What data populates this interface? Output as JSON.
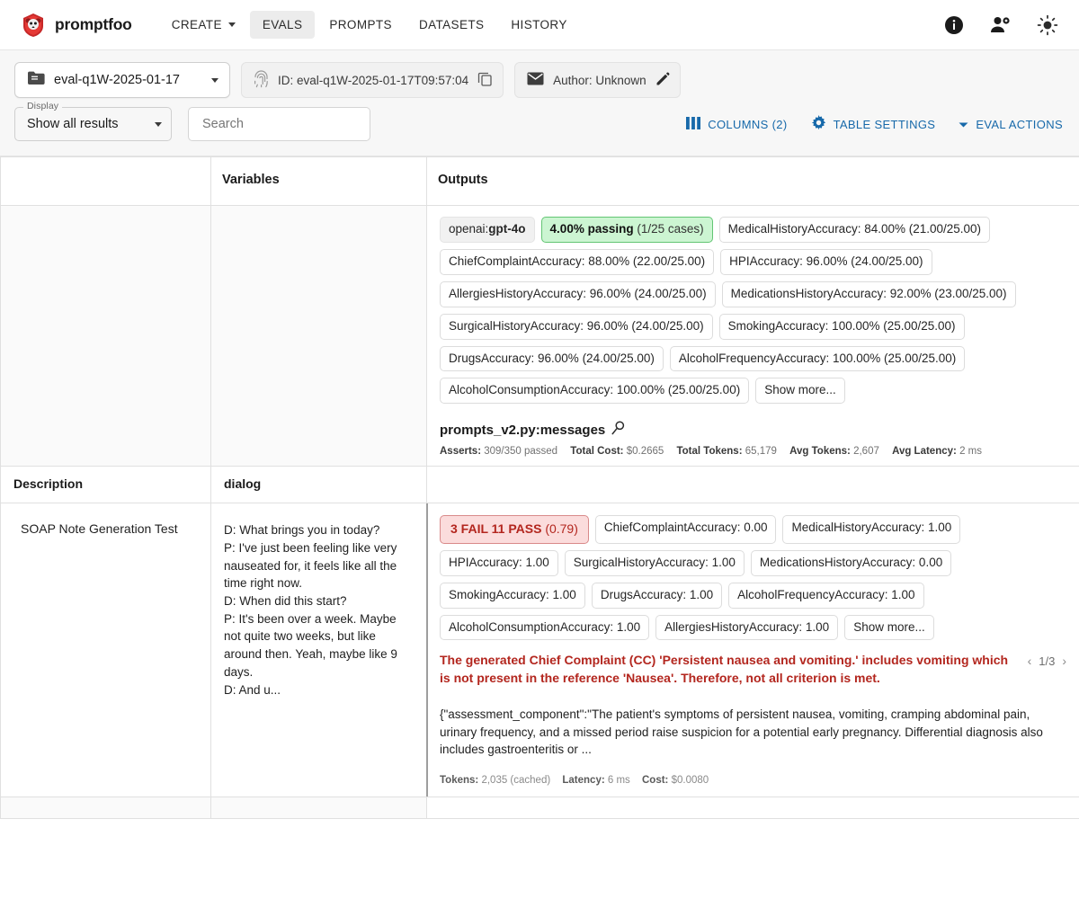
{
  "nav": {
    "brand": "promptfoo",
    "items": [
      {
        "label": "CREATE",
        "has_caret": true,
        "active": false
      },
      {
        "label": "EVALS",
        "has_caret": false,
        "active": true
      },
      {
        "label": "PROMPTS",
        "has_caret": false,
        "active": false
      },
      {
        "label": "DATASETS",
        "has_caret": false,
        "active": false
      },
      {
        "label": "HISTORY",
        "has_caret": false,
        "active": false
      }
    ],
    "right_icons": [
      "info-icon",
      "user-settings-icon",
      "light-mode-icon"
    ]
  },
  "evalbar": {
    "eval_name": "eval-q1W-2025-01-17",
    "id_label": "ID: eval-q1W-2025-01-17T09:57:04",
    "author_label": "Author: Unknown"
  },
  "filters": {
    "display_legend": "Display",
    "display_value": "Show all results",
    "search_placeholder": "Search",
    "columns_label": "COLUMNS (2)",
    "table_settings_label": "TABLE SETTINGS",
    "eval_actions_label": "EVAL ACTIONS",
    "accent_color": "#1769aa"
  },
  "table": {
    "headers": {
      "col1": "",
      "col2": "Variables",
      "col3": "Outputs"
    },
    "subheaders": {
      "col1": "Description",
      "col2": "dialog"
    },
    "summary": {
      "model_prefix": "openai:",
      "model_name": "gpt-4o",
      "passing_main": "4.00% passing",
      "passing_sub": "(1/25 cases)",
      "metrics": [
        "MedicalHistoryAccuracy: 84.00% (21.00/25.00)",
        "ChiefComplaintAccuracy: 88.00% (22.00/25.00)",
        "HPIAccuracy: 96.00% (24.00/25.00)",
        "AllergiesHistoryAccuracy: 96.00% (24.00/25.00)",
        "MedicationsHistoryAccuracy: 92.00% (23.00/25.00)",
        "SurgicalHistoryAccuracy: 96.00% (24.00/25.00)",
        "SmokingAccuracy: 100.00% (25.00/25.00)",
        "DrugsAccuracy: 96.00% (24.00/25.00)",
        "AlcoholFrequencyAccuracy: 100.00% (25.00/25.00)",
        "AlcoholConsumptionAccuracy: 100.00% (25.00/25.00)"
      ],
      "show_more": "Show more...",
      "prompt_title": "prompts_v2.py:messages",
      "stats": [
        {
          "label": "Asserts:",
          "value": "309/350 passed"
        },
        {
          "label": "Total Cost:",
          "value": "$0.2665"
        },
        {
          "label": "Total Tokens:",
          "value": "65,179"
        },
        {
          "label": "Avg Tokens:",
          "value": "2,607"
        },
        {
          "label": "Avg Latency:",
          "value": "2 ms"
        }
      ]
    },
    "row": {
      "description": "SOAP Note Generation Test",
      "dialog": "D: What brings you in today?\nP: I've just been feeling like very nauseated for, it feels like all the time right now.\nD: When did this start?\nP: It's been over a week. Maybe not quite two weeks, but like around then. Yeah, maybe like 9 days.\nD: And u...",
      "verdict_main": "3 FAIL 11 PASS",
      "verdict_sub": "(0.79)",
      "metrics": [
        "ChiefComplaintAccuracy: 0.00",
        "MedicalHistoryAccuracy: 1.00",
        "HPIAccuracy: 1.00",
        "SurgicalHistoryAccuracy: 1.00",
        "MedicationsHistoryAccuracy: 0.00",
        "SmokingAccuracy: 1.00",
        "DrugsAccuracy: 1.00",
        "AlcoholFrequencyAccuracy: 1.00",
        "AlcoholConsumptionAccuracy: 1.00",
        "AllergiesHistoryAccuracy: 1.00"
      ],
      "show_more": "Show more...",
      "error_text": "The generated Chief Complaint (CC) 'Persistent nausea and vomiting.' includes vomiting which is not present in the reference 'Nausea'. Therefore, not all criterion is met.",
      "pager": {
        "prev": "‹",
        "page": "1/3",
        "next": "›"
      },
      "output_json": "{\"assessment_component\":\"The patient's symptoms of persistent nausea, vomiting, cramping abdominal pain, urinary frequency, and a missed period raise suspicion for a potential early pregnancy. Differential diagnosis also includes gastroenteritis or ...",
      "foot_stats": [
        {
          "label": "Tokens:",
          "value": "2,035 (cached)"
        },
        {
          "label": "Latency:",
          "value": "6 ms"
        },
        {
          "label": "Cost:",
          "value": "$0.0080"
        }
      ]
    }
  }
}
